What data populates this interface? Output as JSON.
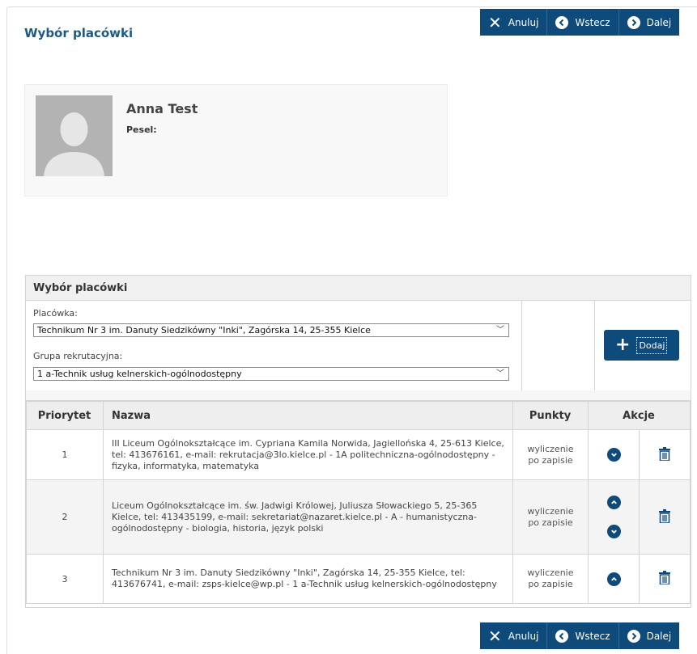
{
  "header": {
    "title": "Wybór placówki"
  },
  "toolbar": {
    "cancel": "Anuluj",
    "back": "Wstecz",
    "next": "Dalej"
  },
  "profile": {
    "name": "Anna Test",
    "pesel_label": "Pesel:"
  },
  "panel": {
    "title": "Wybór placówki",
    "placowka_label": "Placówka:",
    "placowka_value": "Technikum Nr 3 im. Danuty Siedzikówny \"Inki\", Zagórska 14, 25-355 Kielce",
    "grupa_label": "Grupa rekrutacyjna:",
    "grupa_value": "1 a-Technik usług kelnerskich-ogólnodostępny",
    "add_label": "Dodaj"
  },
  "table": {
    "headers": {
      "priority": "Priorytet",
      "name": "Nazwa",
      "points": "Punkty",
      "actions": "Akcje"
    },
    "rows": [
      {
        "priority": "1",
        "name": "III Liceum Ogólnokształcące im. Cypriana Kamila Norwida, Jagiellońska 4, 25-613 Kielce, tel: 413676161, e-mail: rekrutacja@3lo.kielce.pl - 1A politechniczna-ogólnodostępny - fizyka, informatyka, matematyka",
        "points_line1": "wyliczenie",
        "points_line2": "po zapisie"
      },
      {
        "priority": "2",
        "name": "Liceum Ogólnokształcące im. św. Jadwigi Królowej, Juliusza Słowackiego 5, 25-365 Kielce, tel: 413435199, e-mail: sekretariat@nazaret.kielce.pl - A - humanistyczna-ogólnodostępny - biologia, historia, język polski",
        "points_line1": "wyliczenie",
        "points_line2": "po zapisie"
      },
      {
        "priority": "3",
        "name": "Technikum Nr 3 im. Danuty Siedzikówny \"Inki\", Zagórska 14, 25-355 Kielce, tel: 413676741, e-mail: zsps-kielce@wp.pl - 1 a-Technik usług kelnerskich-ogólnodostępny",
        "points_line1": "wyliczenie",
        "points_line2": "po zapisie"
      }
    ]
  },
  "colors": {
    "primary": "#0e4a7a",
    "title": "#1b5a86"
  }
}
